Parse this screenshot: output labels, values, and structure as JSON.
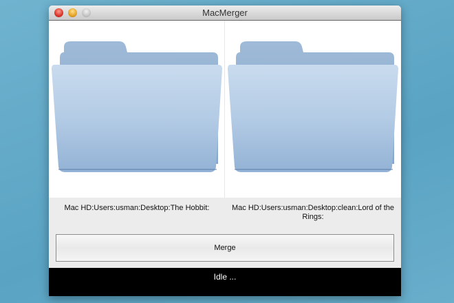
{
  "window": {
    "title": "MacMerger"
  },
  "sources": [
    {
      "path": "Mac HD:Users:usman:Desktop:The Hobbit:",
      "icon": "folder-icon"
    },
    {
      "path": "Mac HD:Users:usman:Desktop:clean:Lord of the Rings:",
      "icon": "folder-icon"
    }
  ],
  "merge_label": "Merge",
  "status": "Idle ...",
  "colors": {
    "folder": "#a9c4e0",
    "status_bg": "#000000"
  }
}
